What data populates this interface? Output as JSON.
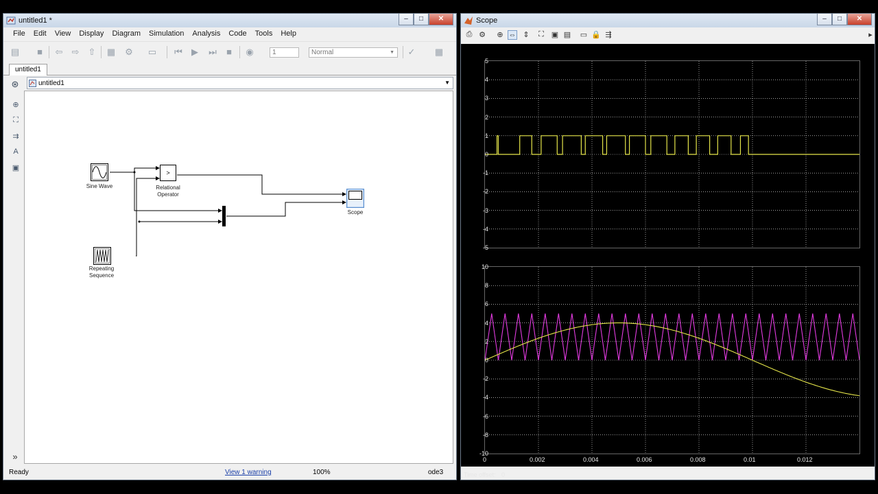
{
  "simulink": {
    "title": "untitled1 *",
    "menu": [
      "File",
      "Edit",
      "View",
      "Display",
      "Diagram",
      "Simulation",
      "Analysis",
      "Code",
      "Tools",
      "Help"
    ],
    "toolbar": {
      "stop_time": "1",
      "sim_mode": "Normal"
    },
    "tab": "untitled1",
    "breadcrumb": "untitled1",
    "blocks": {
      "sine_wave": "Sine Wave",
      "relational_operator_line1": "Relational",
      "relational_operator_line2": "Operator",
      "relational_symbol": ">",
      "repeating_line1": "Repeating",
      "repeating_line2": "Sequence",
      "scope": "Scope"
    },
    "status": {
      "state": "Ready",
      "warning": "View 1 warning",
      "zoom": "100%",
      "solver": "ode3"
    }
  },
  "scope": {
    "title": "Scope",
    "time_offset_label": "Time offset:",
    "time_offset_value": "0"
  },
  "colors": {
    "yellow": "#e6e64a",
    "magenta": "#e23be0",
    "grid": "#ffffff"
  },
  "chart_data": [
    {
      "type": "line",
      "title": "",
      "xlim": [
        0,
        0.014
      ],
      "ylim": [
        -5,
        5
      ],
      "yticks": [
        "5",
        "4",
        "3",
        "2",
        "1",
        "0",
        "-1",
        "-2",
        "-3",
        "-4",
        "-5"
      ],
      "grid": true,
      "series": [
        {
          "color": "#e6e64a",
          "description": "PWM pulses 0/1, 12 pulses until t=0.01, then 0",
          "pulses": [
            [
              0.00045,
              0.0005
            ],
            [
              0.0013,
              0.00175
            ],
            [
              0.0021,
              0.0027
            ],
            [
              0.0029,
              0.0036
            ],
            [
              0.00375,
              0.0044
            ],
            [
              0.00455,
              0.00525
            ],
            [
              0.0054,
              0.006
            ],
            [
              0.0062,
              0.0068
            ],
            [
              0.0071,
              0.0076
            ],
            [
              0.0079,
              0.0084
            ],
            [
              0.0087,
              0.0092
            ],
            [
              0.00955,
              0.00985
            ]
          ],
          "y_high": 1,
          "y_low": 0
        }
      ]
    },
    {
      "type": "line",
      "title": "",
      "xlim": [
        0,
        0.014
      ],
      "ylim": [
        -10,
        10
      ],
      "xticks": [
        "0",
        "0.002",
        "0.004",
        "0.006",
        "0.008",
        "0.01",
        "0.012"
      ],
      "yticks": [
        "10",
        "8",
        "6",
        "4",
        "2",
        "0",
        "-2",
        "-4",
        "-6",
        "-8",
        "-10"
      ],
      "grid": true,
      "series": [
        {
          "color": "#e23be0",
          "kind": "triangle",
          "min": 0,
          "max": 5,
          "period": 0.0005
        },
        {
          "color": "#e6e64a",
          "kind": "sine",
          "amplitude": 4,
          "frequency": 50
        }
      ]
    }
  ]
}
